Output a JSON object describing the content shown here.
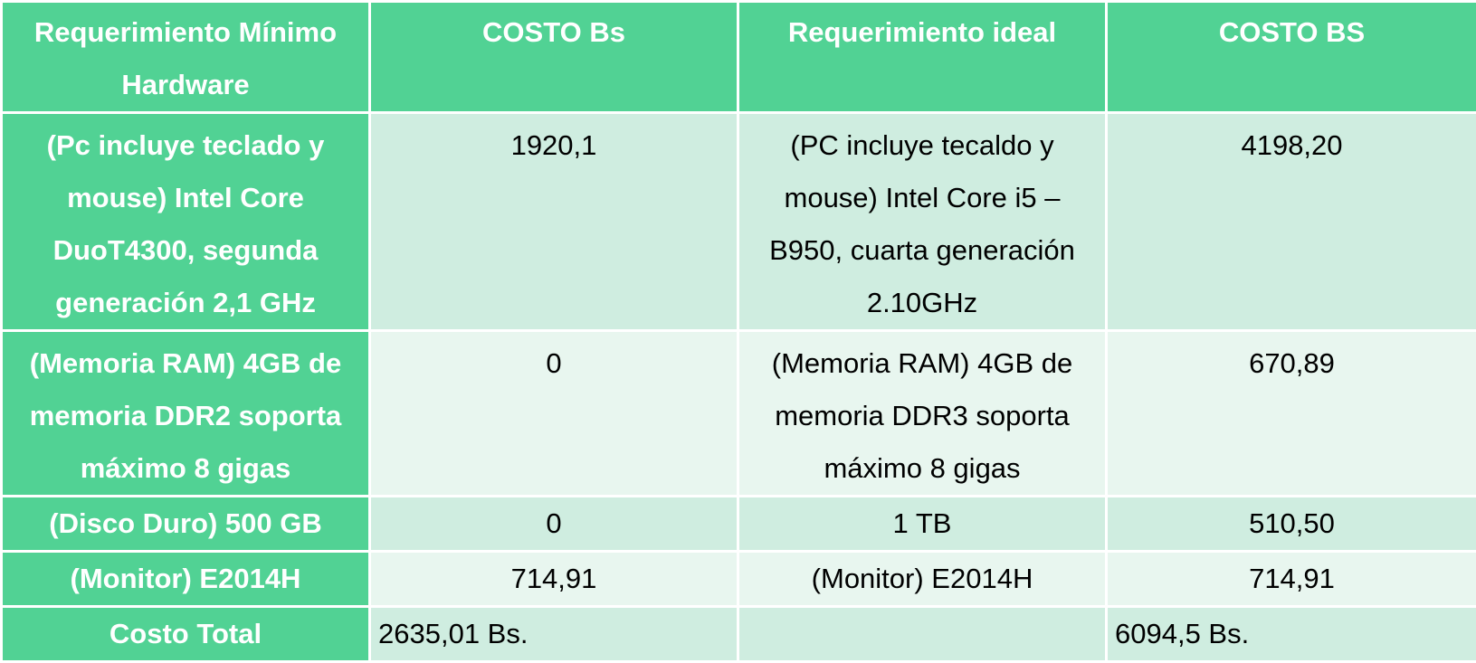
{
  "header": {
    "col1": "Requerimiento Mínimo Hardware",
    "col2": "COSTO Bs",
    "col3": "Requerimiento ideal",
    "col4": "COSTO BS"
  },
  "rows": [
    {
      "minimo": "(Pc incluye teclado y mouse) Intel Core DuoT4300, segunda generación 2,1 GHz",
      "costo_minimo": "1920,1",
      "ideal": "(PC incluye tecaldo y mouse) Intel Core i5 – B950, cuarta generación 2.10GHz",
      "costo_ideal": "4198,20"
    },
    {
      "minimo": "(Memoria RAM) 4GB de memoria DDR2 soporta máximo 8 gigas",
      "costo_minimo": "0",
      "ideal": "(Memoria RAM) 4GB de memoria DDR3 soporta máximo 8 gigas",
      "costo_ideal": "670,89"
    },
    {
      "minimo": "(Disco Duro) 500 GB",
      "costo_minimo": "0",
      "ideal": "1 TB",
      "costo_ideal": "510,50"
    },
    {
      "minimo": "(Monitor) E2014H",
      "costo_minimo": "714,91",
      "ideal": "(Monitor) E2014H",
      "costo_ideal": "714,91"
    }
  ],
  "total": {
    "label": "Costo Total",
    "costo_minimo": "2635,01 Bs.",
    "ideal": "",
    "costo_ideal": "6094,5 Bs."
  },
  "colors": {
    "header_green": "#51d294",
    "row_dark": "#cfede0",
    "row_light": "#e8f6ef"
  }
}
